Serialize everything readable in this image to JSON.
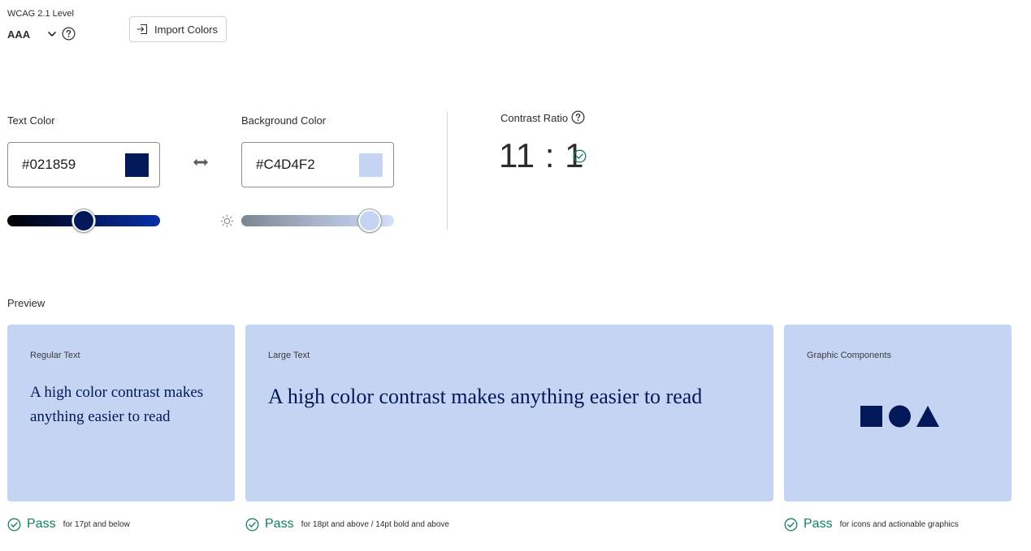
{
  "wcag": {
    "label": "WCAG 2.1 Level",
    "value": "AAA"
  },
  "import_button": {
    "label": "Import Colors"
  },
  "text_color": {
    "label": "Text Color",
    "value": "#021859",
    "swatch": "#021859"
  },
  "background_color": {
    "label": "Background Color",
    "value": "#C4D4F2",
    "swatch": "#C4D4F2"
  },
  "sliders": {
    "text_color_level": 0.5,
    "background_color_level": 0.9
  },
  "contrast": {
    "label": "Contrast Ratio",
    "value": "11 : 1"
  },
  "preview": {
    "label": "Preview",
    "regular": {
      "title": "Regular Text",
      "text": "A high color contrast makes anything easier to read"
    },
    "large": {
      "title": "Large Text",
      "text": "A high color contrast makes anything easier to read"
    },
    "graphic": {
      "title": "Graphic Components"
    }
  },
  "results": {
    "regular": {
      "status": "Pass",
      "desc": "for 17pt and below"
    },
    "large": {
      "status": "Pass",
      "desc": "for 18pt and above / 14pt bold and above"
    },
    "graphic": {
      "status": "Pass",
      "desc": "for icons and actionable graphics"
    }
  },
  "colors": {
    "pass_green": "#12805c",
    "border": "#8e8e8e"
  },
  "icons": {
    "chevron": "chevron-down-icon",
    "help": "help-circle-icon",
    "import": "import-icon",
    "swap": "swap-horizontal-icon",
    "brightness": "brightness-icon",
    "check": "checkmark-circle-icon"
  }
}
